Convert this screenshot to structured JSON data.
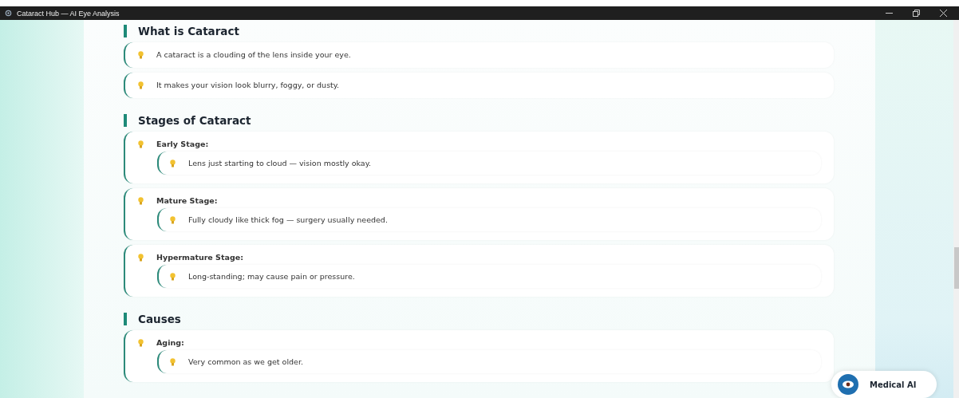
{
  "window": {
    "title": "Cataract Hub — AI Eye Analysis"
  },
  "sections": [
    {
      "heading": "What is Cataract",
      "items": [
        {
          "kind": "text",
          "text": "A cataract is a clouding of the lens inside your eye."
        },
        {
          "kind": "text",
          "text": "It makes your vision look blurry, foggy, or dusty."
        }
      ]
    },
    {
      "heading": "Stages of Cataract",
      "items": [
        {
          "kind": "group",
          "label": "Early Stage:",
          "children": [
            {
              "text": "Lens just starting to cloud — vision mostly okay."
            }
          ]
        },
        {
          "kind": "group",
          "label": "Mature Stage:",
          "children": [
            {
              "text": "Fully cloudy like thick fog — surgery usually needed."
            }
          ]
        },
        {
          "kind": "group",
          "label": "Hypermature Stage:",
          "children": [
            {
              "text": "Long-standing; may cause pain or pressure."
            }
          ]
        }
      ]
    },
    {
      "heading": "Causes",
      "items": [
        {
          "kind": "group",
          "label": "Aging:",
          "children": [
            {
              "text": "Very common as we get older."
            }
          ]
        }
      ]
    }
  ],
  "assistant_button": {
    "label": "Medical AI"
  }
}
